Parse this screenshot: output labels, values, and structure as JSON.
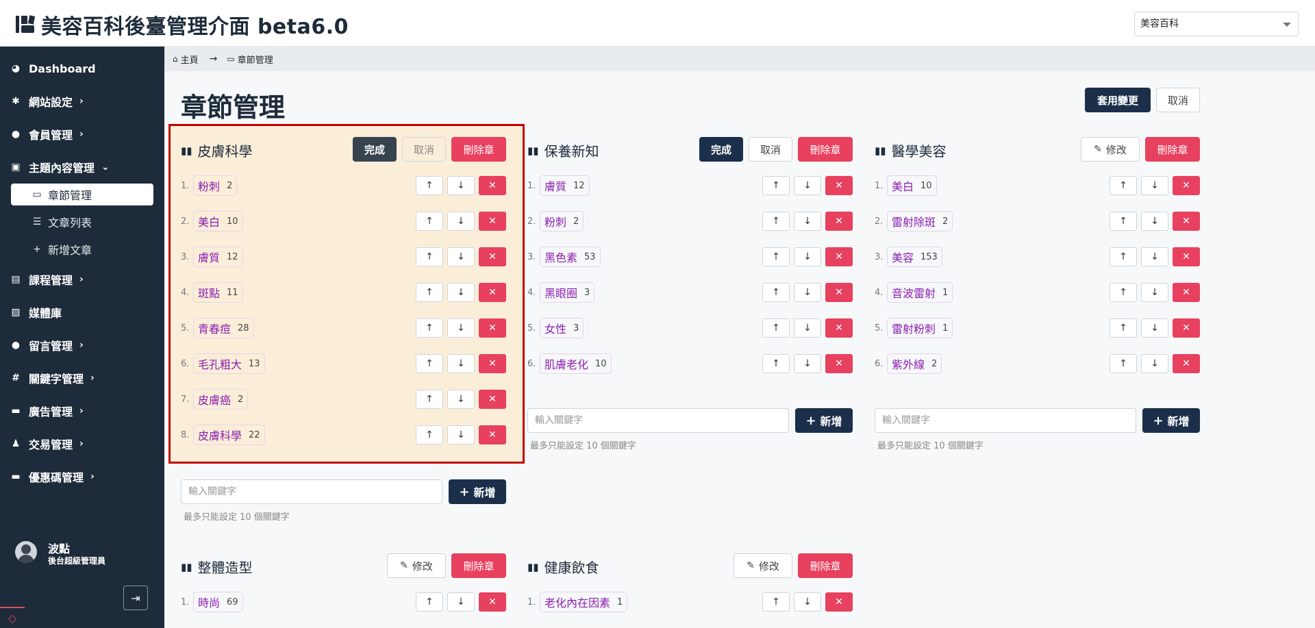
{
  "header": {
    "app_title": "美容百科後臺管理介面 beta6.0",
    "site_selector_value": "美容百科"
  },
  "sidebar": {
    "items": [
      {
        "label": "Dashboard",
        "icon": "dashboard-icon"
      },
      {
        "label": "網站設定",
        "icon": "gear-icon"
      },
      {
        "label": "會員管理",
        "icon": "users-icon"
      },
      {
        "label": "主題內容管理",
        "icon": "content-icon"
      },
      {
        "label": "課程管理",
        "icon": "book-icon"
      },
      {
        "label": "媒體庫",
        "icon": "images-icon"
      },
      {
        "label": "留言管理",
        "icon": "comment-icon"
      },
      {
        "label": "關鍵字管理",
        "icon": "hash-icon"
      },
      {
        "label": "廣告管理",
        "icon": "ad-icon"
      },
      {
        "label": "交易管理",
        "icon": "money-bag-icon"
      },
      {
        "label": "優惠碼管理",
        "icon": "ticket-icon"
      }
    ],
    "sub_items": [
      {
        "label": "章節管理",
        "icon": "chapter-icon"
      },
      {
        "label": "文章列表",
        "icon": "list-icon"
      },
      {
        "label": "新增文章",
        "icon": "plus-icon"
      }
    ],
    "user": {
      "name": "波點",
      "role": "後台超級管理員"
    }
  },
  "breadcrumb": {
    "home": "主頁",
    "current": "章節管理"
  },
  "page": {
    "title": "章節管理",
    "apply_label": "套用變更",
    "cancel_label": "取消"
  },
  "labels": {
    "done": "完成",
    "cancel": "取消",
    "delete_chapter": "刪除章",
    "edit": "修改",
    "add": "新增",
    "input_placeholder": "輸入關鍵字",
    "limit_hint": "最多只能設定 10 個關鍵字",
    "up": "↑",
    "down": "↓",
    "remove": "✕"
  },
  "chapters": [
    {
      "title": "皮膚科學",
      "keywords": [
        {
          "num": "1.",
          "name": "粉刺",
          "count": "2"
        },
        {
          "num": "2.",
          "name": "美白",
          "count": "10"
        },
        {
          "num": "3.",
          "name": "膚質",
          "count": "12"
        },
        {
          "num": "4.",
          "name": "斑點",
          "count": "11"
        },
        {
          "num": "5.",
          "name": "青春痘",
          "count": "28"
        },
        {
          "num": "6.",
          "name": "毛孔粗大",
          "count": "13"
        },
        {
          "num": "7.",
          "name": "皮膚癌",
          "count": "2"
        },
        {
          "num": "8.",
          "name": "皮膚科學",
          "count": "22"
        }
      ]
    },
    {
      "title": "保養新知",
      "keywords": [
        {
          "num": "1.",
          "name": "膚質",
          "count": "12"
        },
        {
          "num": "2.",
          "name": "粉刺",
          "count": "2"
        },
        {
          "num": "3.",
          "name": "黑色素",
          "count": "53"
        },
        {
          "num": "4.",
          "name": "黑眼圈",
          "count": "3"
        },
        {
          "num": "5.",
          "name": "女性",
          "count": "3"
        },
        {
          "num": "6.",
          "name": "肌膚老化",
          "count": "10"
        }
      ]
    },
    {
      "title": "醫學美容",
      "keywords": [
        {
          "num": "1.",
          "name": "美白",
          "count": "10"
        },
        {
          "num": "2.",
          "name": "雷射除斑",
          "count": "2"
        },
        {
          "num": "3.",
          "name": "美容",
          "count": "153"
        },
        {
          "num": "4.",
          "name": "音波雷射",
          "count": "1"
        },
        {
          "num": "5.",
          "name": "雷射粉刺",
          "count": "1"
        },
        {
          "num": "6.",
          "name": "紫外線",
          "count": "2"
        }
      ]
    },
    {
      "title": "整體造型",
      "keywords": [
        {
          "num": "1.",
          "name": "時尚",
          "count": "69"
        }
      ]
    },
    {
      "title": "健康飲食",
      "keywords": [
        {
          "num": "1.",
          "name": "老化內在因素",
          "count": "1"
        }
      ]
    }
  ]
}
